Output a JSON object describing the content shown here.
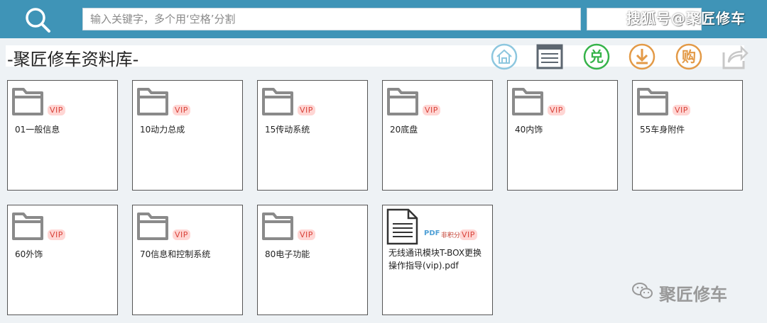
{
  "search": {
    "placeholder": "输入关键字，多个用‘空格’分割"
  },
  "watermark_top": "搜狐号@聚匠修车",
  "title": "-聚匠修车资料库-",
  "toolbar": [
    {
      "name": "home",
      "color": "#8dc7df"
    },
    {
      "name": "list",
      "color": "#5c6670"
    },
    {
      "name": "redeem",
      "label": "兑",
      "color": "#36b34a"
    },
    {
      "name": "download",
      "color": "#e39a47"
    },
    {
      "name": "buy",
      "label": "购",
      "color": "#e39a47"
    },
    {
      "name": "share",
      "color": "#c8c8c8"
    }
  ],
  "vip_label": "VIP",
  "folders": [
    {
      "label": "01一般信息"
    },
    {
      "label": "10动力总成"
    },
    {
      "label": "15传动系统"
    },
    {
      "label": "20底盘"
    },
    {
      "label": "40内饰"
    },
    {
      "label": "55车身附件"
    },
    {
      "label": "60外饰"
    },
    {
      "label": "70信息和控制系统"
    },
    {
      "label": "80电子功能"
    }
  ],
  "file": {
    "label": "无线通讯模块T-BOX更换操作指导(vip).pdf",
    "type_badge": "PDF",
    "points_badge": "非积分"
  },
  "watermark_bottom": "聚匠修车"
}
